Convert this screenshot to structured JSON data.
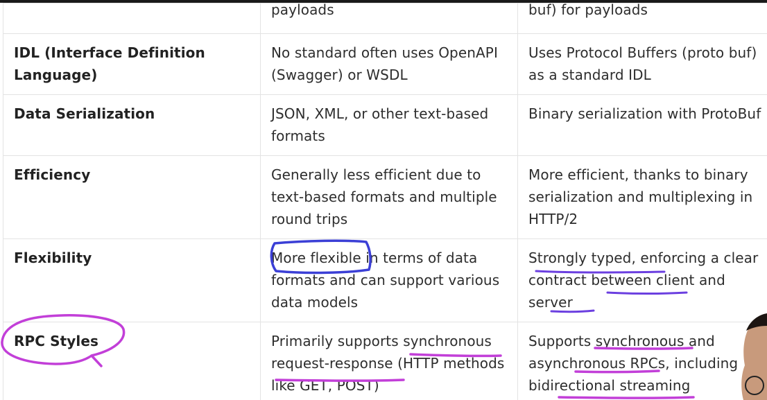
{
  "table": {
    "rows": [
      {
        "feature": "",
        "rest": "payloads",
        "grpc": "buf) for payloads"
      },
      {
        "feature": "IDL (Interface Definition Language)",
        "rest": "No standard often uses OpenAPI (Swagger) or WSDL",
        "grpc": "Uses Protocol Buffers (proto buf) as a standard IDL"
      },
      {
        "feature": "Data Serialization",
        "rest": "JSON, XML, or other text-based formats",
        "grpc": "Binary serialization with ProtoBuf"
      },
      {
        "feature": "Efficiency",
        "rest": "Generally less efficient due to text-based formats and multiple round trips",
        "grpc": "More efficient, thanks to binary serialization and multiplexing in HTTP/2"
      },
      {
        "feature": "Flexibility",
        "rest": "More flexible in terms of data formats and can support various data models",
        "grpc": "Strongly typed, enforcing a clear contract between client and server"
      },
      {
        "feature": "RPC Styles",
        "rest": "Primarily supports synchronous request-response (HTTP methods like GET, POST)",
        "grpc": "Supports synchronous and asynchronous RPCs, including bidirectional streaming"
      }
    ]
  },
  "annotations": {
    "ink_purple": "#6b3fe0",
    "ink_magenta": "#c23fd8",
    "ink_blue": "#3b3fd6"
  },
  "colors": {
    "border": "#e3e3e3",
    "text": "#2d2d2d",
    "top_bar": "#1a1a1a"
  }
}
